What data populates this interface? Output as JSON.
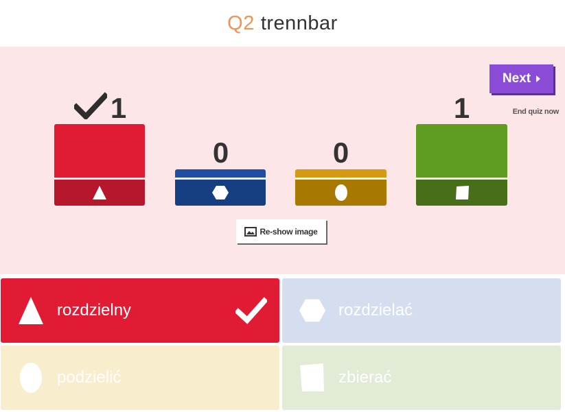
{
  "header": {
    "question_number": "Q2",
    "question_text": "trennbar"
  },
  "controls": {
    "next_label": "Next",
    "end_quiz_label": "End quiz now",
    "reshow_label": "Re-show image"
  },
  "results": [
    {
      "shape": "triangle",
      "count": "1",
      "correct": true,
      "top_color": "#e21b35",
      "bottom_color": "#b7172c"
    },
    {
      "shape": "hexagon",
      "count": "0",
      "correct": false,
      "top_color": "#1e4fa0",
      "bottom_color": "#163f81"
    },
    {
      "shape": "circle",
      "count": "0",
      "correct": false,
      "top_color": "#d49b12",
      "bottom_color": "#a87900"
    },
    {
      "shape": "square",
      "count": "1",
      "correct": false,
      "top_color": "#5e9c22",
      "bottom_color": "#476e19"
    }
  ],
  "answers": [
    {
      "label": "rozdzielny",
      "shape": "triangle",
      "correct": true,
      "color": "#e21b35"
    },
    {
      "label": "rozdzielać",
      "shape": "hexagon",
      "correct": false,
      "color": "#d4deee"
    },
    {
      "label": "podzielić",
      "shape": "circle",
      "correct": false,
      "color": "#f8edcd"
    },
    {
      "label": "zbierać",
      "shape": "square",
      "correct": false,
      "color": "#e1ebd6"
    }
  ]
}
